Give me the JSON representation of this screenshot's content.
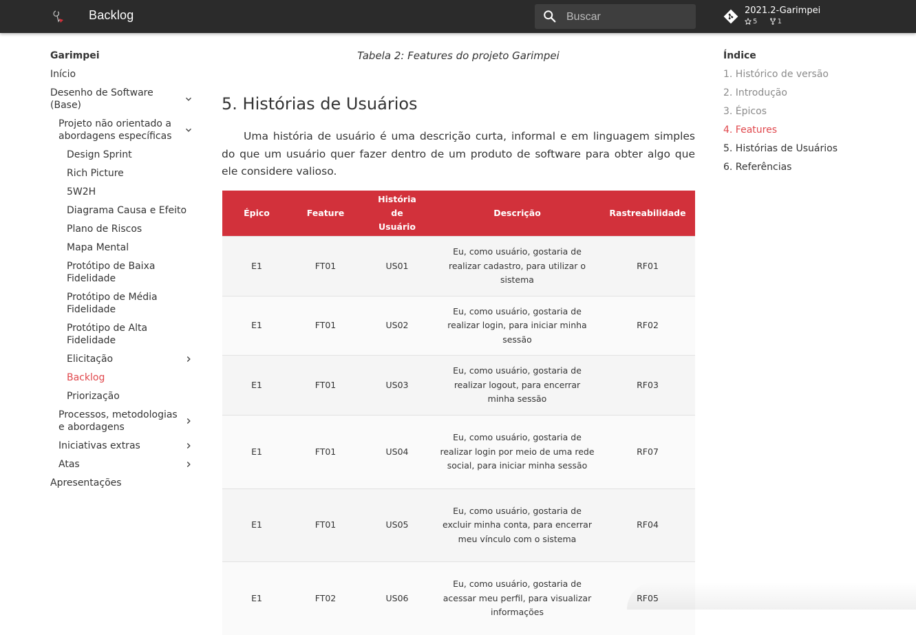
{
  "header": {
    "title": "Backlog",
    "search_placeholder": "Buscar",
    "repo": {
      "name": "2021.2-Garimpei",
      "stars": "5",
      "forks": "1"
    }
  },
  "nav": {
    "site_title": "Garimpei",
    "items": [
      {
        "label": "Início"
      },
      {
        "label": "Desenho de Software (Base)"
      },
      {
        "label": "Projeto não orientado a abordagens específicas"
      },
      {
        "label": "Design Sprint"
      },
      {
        "label": "Rich Picture"
      },
      {
        "label": "5W2H"
      },
      {
        "label": "Diagrama Causa e Efeito"
      },
      {
        "label": "Plano de Riscos"
      },
      {
        "label": "Mapa Mental"
      },
      {
        "label": "Protótipo de Baixa Fidelidade"
      },
      {
        "label": "Protótipo de Média Fidelidade"
      },
      {
        "label": "Protótipo de Alta Fidelidade"
      },
      {
        "label": "Elicitação"
      },
      {
        "label": "Backlog"
      },
      {
        "label": "Priorização"
      },
      {
        "label": "Processos, metodologias e abordagens"
      },
      {
        "label": "Iniciativas extras"
      },
      {
        "label": "Atas"
      },
      {
        "label": "Apresentações"
      }
    ]
  },
  "main": {
    "caption": "Tabela 2: Features do projeto Garimpei",
    "heading": "5. Histórias de Usuários",
    "paragraph": "Uma história de usuário é uma descrição curta, informal e em linguagem simples do que um usuário quer fazer dentro de um produto de software para obter algo que ele considere valioso.",
    "table": {
      "headers": [
        "Épico",
        "Feature",
        "História de Usuário",
        "Descrição",
        "Rastreabilidade"
      ],
      "rows": [
        [
          "E1",
          "FT01",
          "US01",
          "Eu, como usuário, gostaria de realizar cadastro, para utilizar o sistema",
          "RF01"
        ],
        [
          "E1",
          "FT01",
          "US02",
          "Eu, como usuário, gostaria de realizar login, para iniciar minha sessão",
          "RF02"
        ],
        [
          "E1",
          "FT01",
          "US03",
          "Eu, como usuário, gostaria de realizar logout, para encerrar minha sessão",
          "RF03"
        ],
        [
          "E1",
          "FT01",
          "US04",
          "Eu, como usuário, gostaria de realizar login por meio de uma rede social, para iniciar minha sessão",
          "RF07"
        ],
        [
          "E1",
          "FT01",
          "US05",
          "Eu, como usuário, gostaria de excluir minha conta, para encerrar meu vínculo com o sistema",
          "RF04"
        ],
        [
          "E1",
          "FT02",
          "US06",
          "Eu, como usuário, gostaria de acessar meu perfil, para visualizar informações",
          "RF05"
        ]
      ]
    }
  },
  "toc": {
    "title": "Índice",
    "items": [
      {
        "label": "1. Histórico de versão"
      },
      {
        "label": "2. Introdução"
      },
      {
        "label": "3. Épicos"
      },
      {
        "label": "4. Features"
      },
      {
        "label": "5. Histórias de Usuários"
      },
      {
        "label": "6. Referências"
      }
    ]
  },
  "colors": {
    "header_bg": "#2b2b2b",
    "accent": "#d2313b",
    "active_link": "#e0474c"
  }
}
